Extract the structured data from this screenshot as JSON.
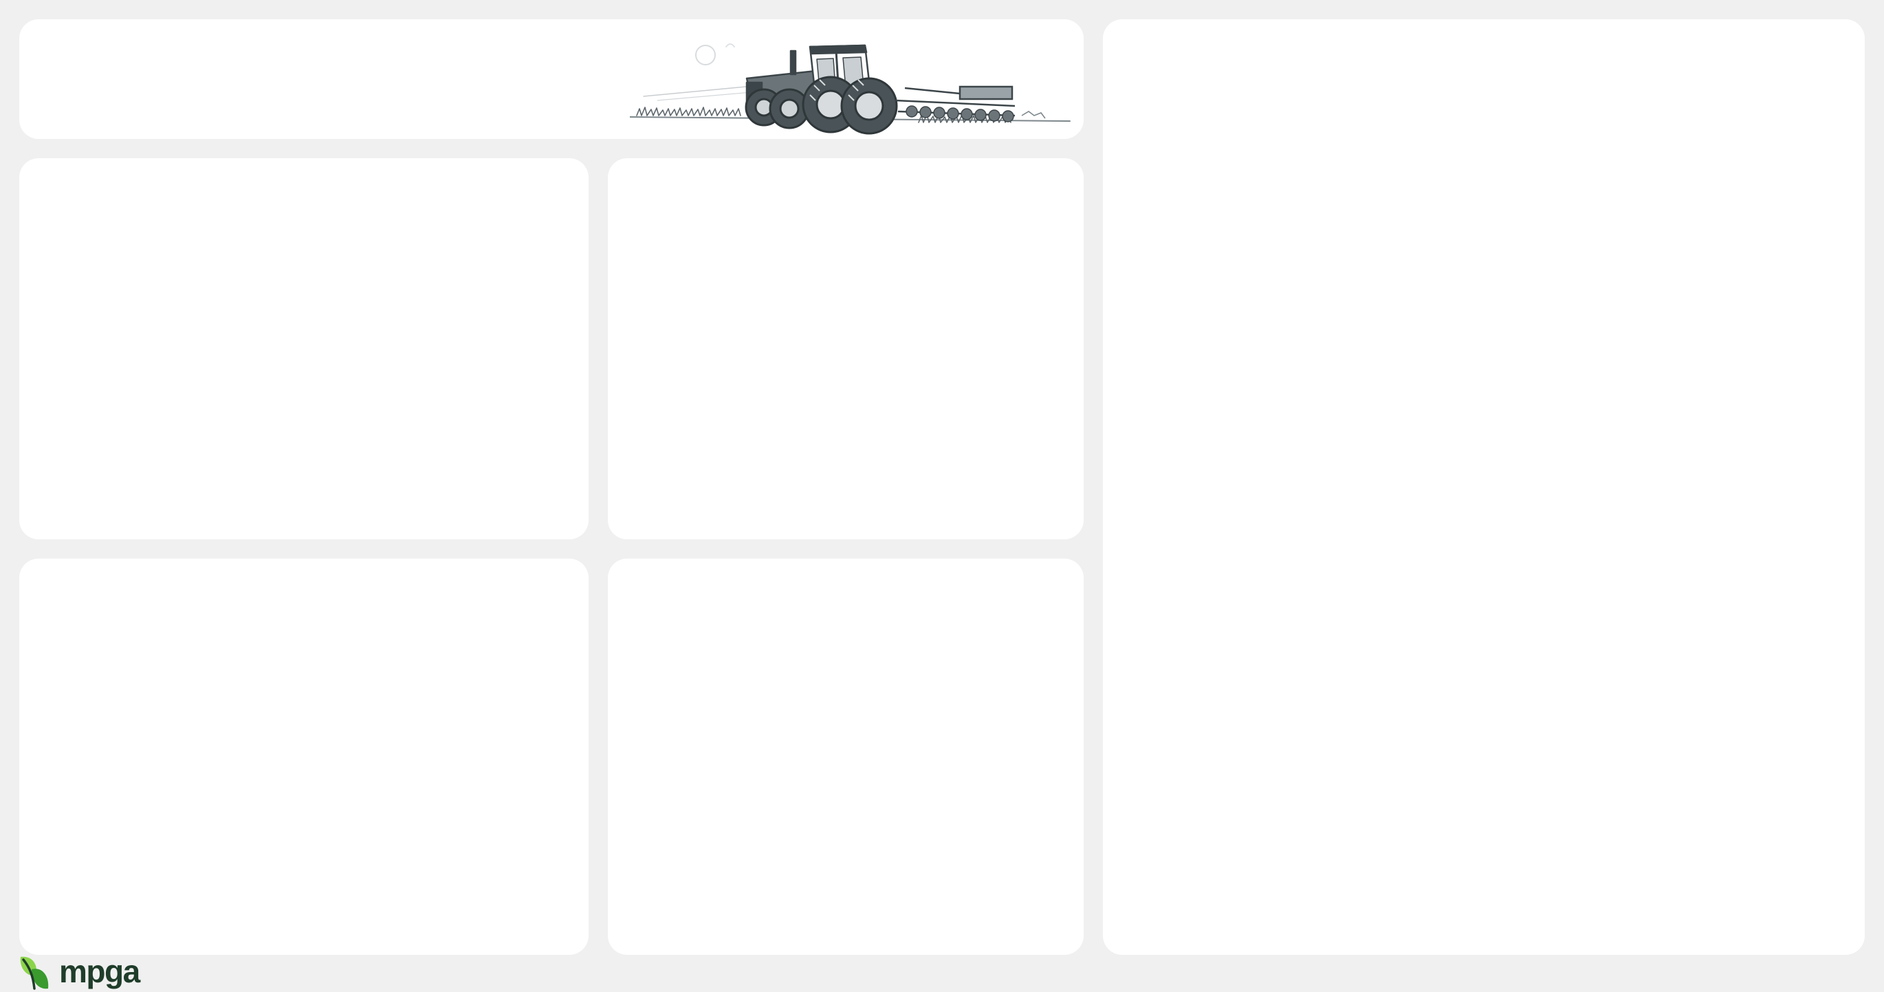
{
  "brand": {
    "name": "mpga",
    "logo_icon": "leaf-mark-icon",
    "colors": {
      "leaf_light": "#8bd44a",
      "leaf_dark": "#3a9a2e",
      "wordmark": "#1f3d2a"
    }
  },
  "header": {
    "illustration": "tractor-with-harrow-sketch"
  },
  "theme": {
    "page_background": "#f0f0f0",
    "card_background": "#ffffff"
  }
}
